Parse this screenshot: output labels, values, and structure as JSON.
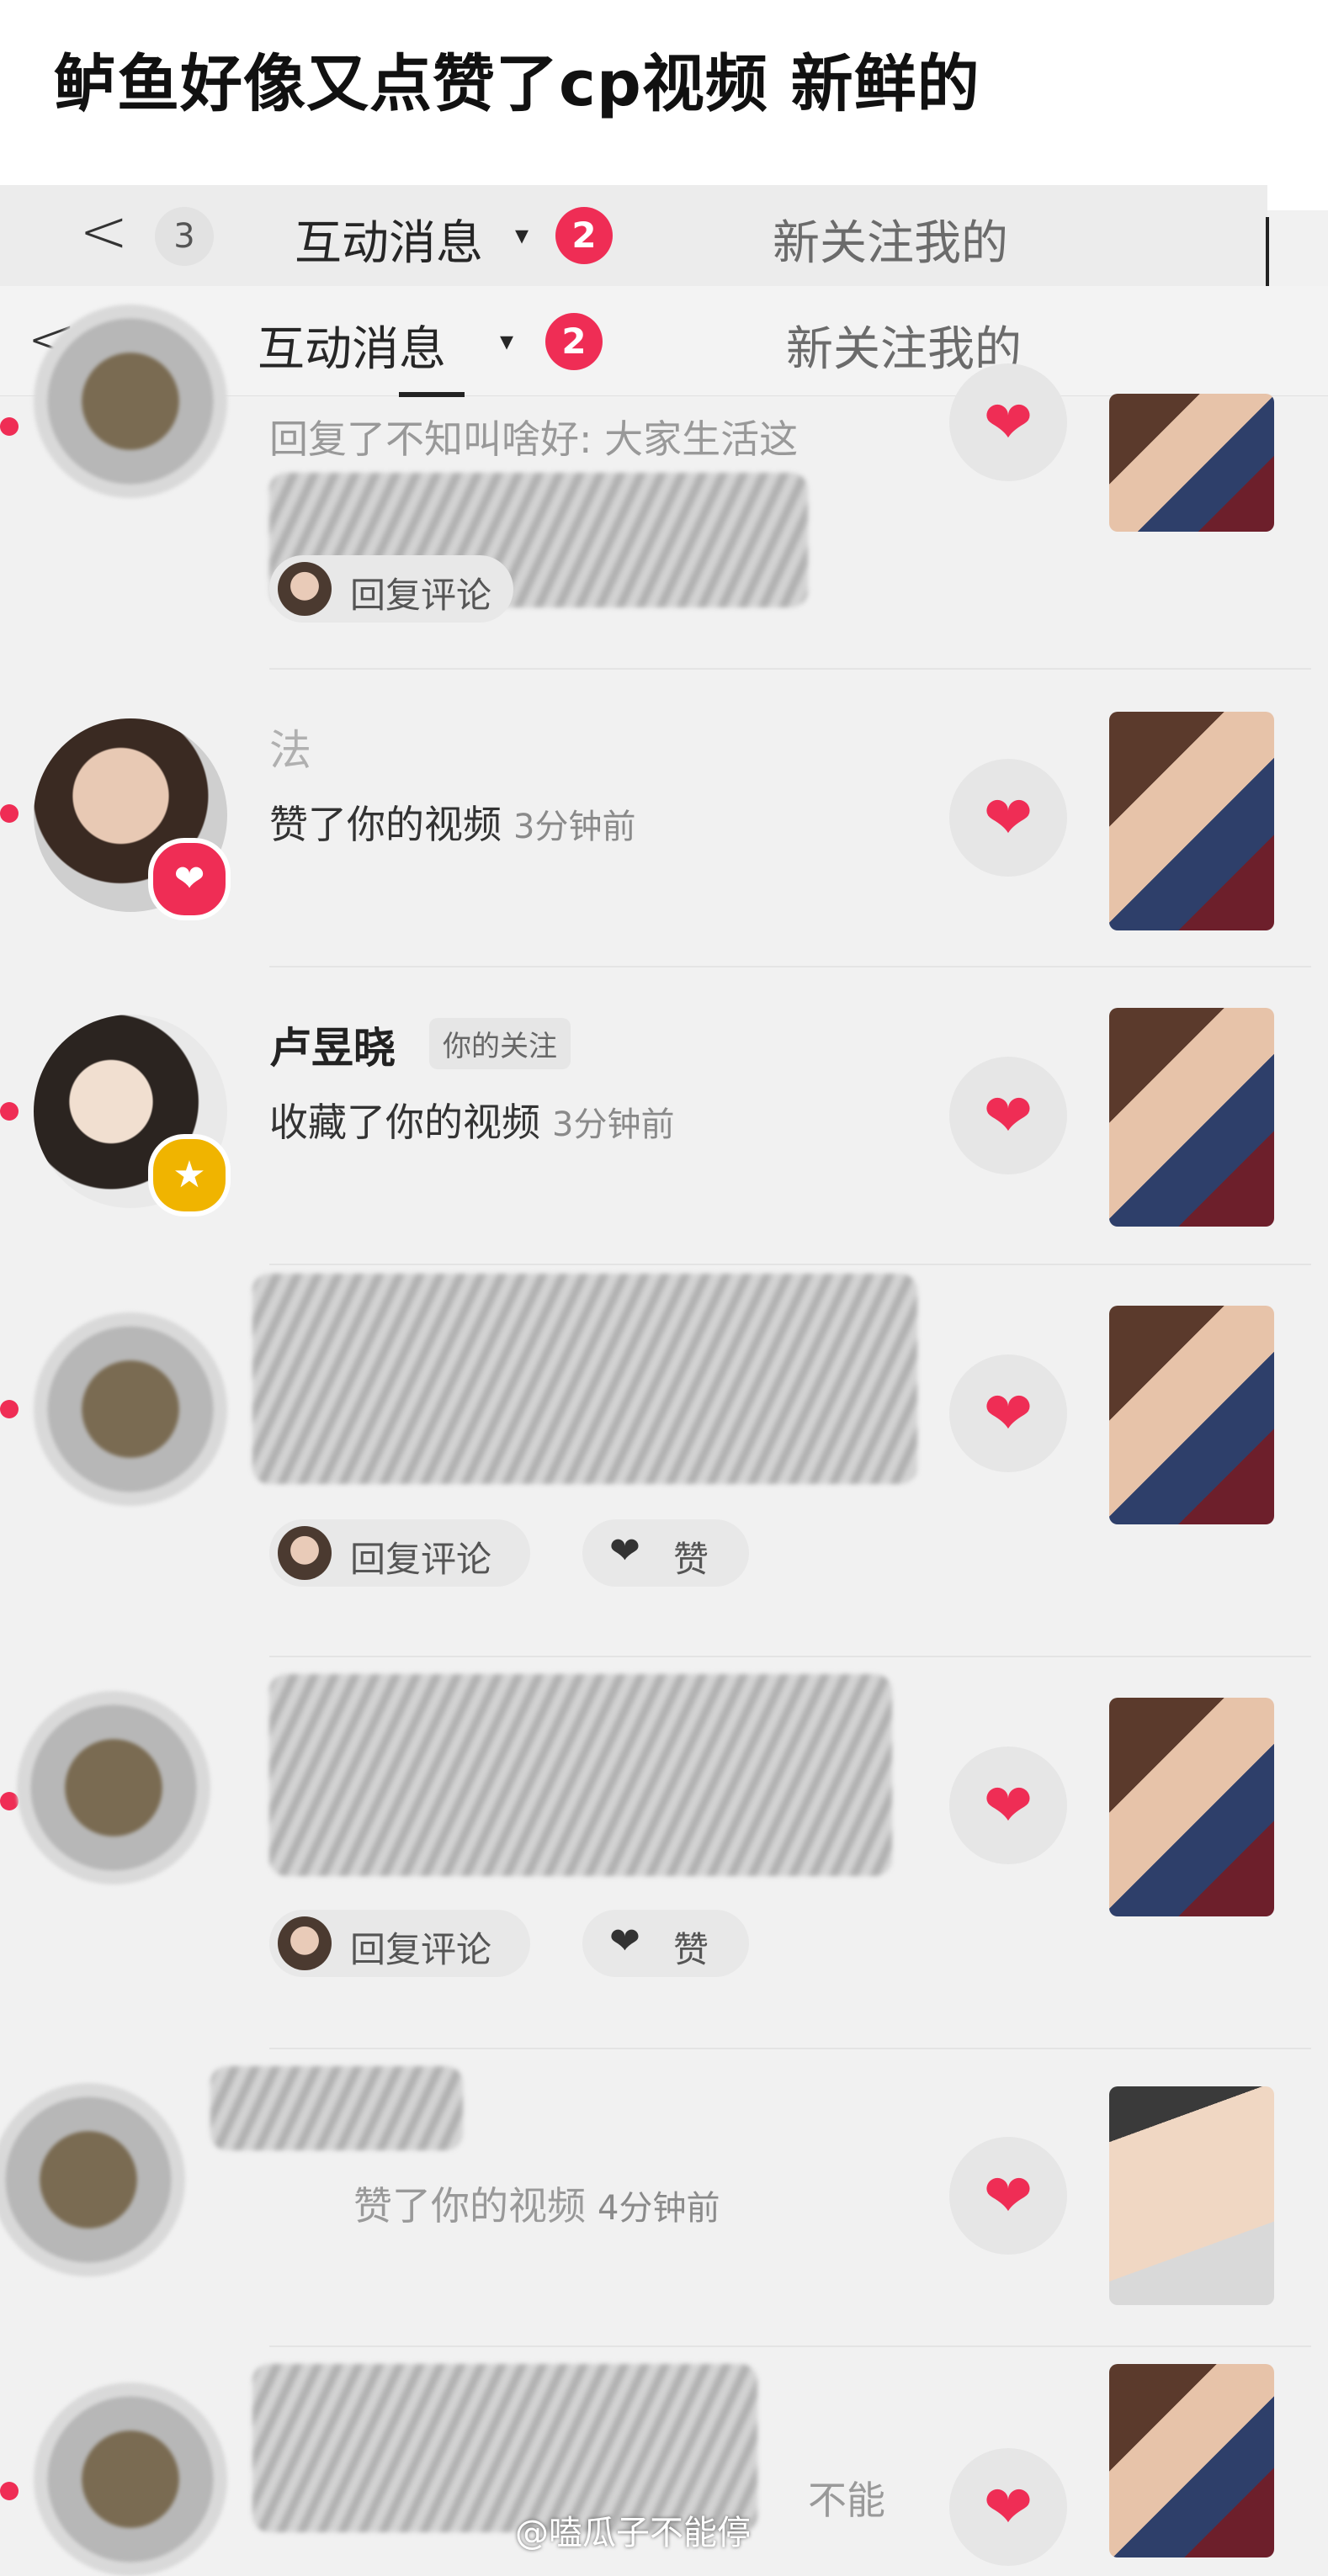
{
  "caption": "鲈鱼好像又点赞了cp视频 新鲜的",
  "header_back": {
    "back_arrow": "<",
    "count": "3",
    "tab_label": "互动消息",
    "badge": "2",
    "right_label": "新关注我的"
  },
  "header": {
    "back_arrow": "<",
    "count": "3",
    "tab_label": "互动消息",
    "badge": "2",
    "right_label": "新关注我的"
  },
  "notifications": [
    {
      "name": "",
      "action": "回复了不知叫啥好: 大家生活这",
      "time": "",
      "reply_label": "回复评论",
      "like_label": ""
    },
    {
      "name": "法",
      "action": "赞了你的视频",
      "time": "3分钟前"
    },
    {
      "name": "卢昱晓",
      "tag": "你的关注",
      "action": "收藏了你的视频",
      "time": "3分钟前"
    },
    {
      "name": "",
      "action": "",
      "time": "",
      "reply_label": "回复评论",
      "like_label": "赞"
    },
    {
      "name": "",
      "action": "",
      "time": "",
      "reply_label": "回复评论",
      "like_label": "赞"
    },
    {
      "name": "",
      "action": "赞了你的视频",
      "time": "4分钟前"
    },
    {
      "name": "",
      "action": "不能",
      "time": ""
    }
  ],
  "icons": {
    "heart": "❤",
    "star": "★",
    "caret": "▾"
  },
  "colors": {
    "accent": "#ef2d55",
    "star_badge": "#f0b400"
  },
  "watermark": "@嗑瓜子不能停"
}
